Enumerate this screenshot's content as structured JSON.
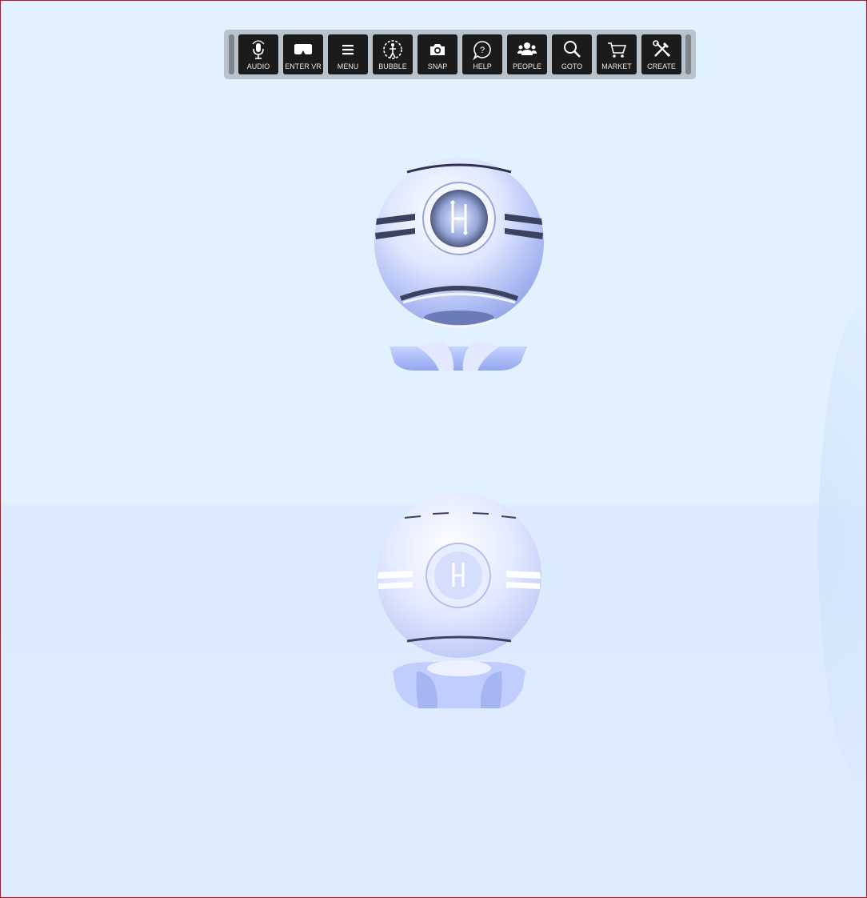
{
  "toolbar": {
    "buttons": [
      {
        "label": "AUDIO",
        "icon": "microphone-icon"
      },
      {
        "label": "ENTER VR",
        "icon": "vr-headset-icon"
      },
      {
        "label": "MENU",
        "icon": "hamburger-menu-icon"
      },
      {
        "label": "BUBBLE",
        "icon": "bubble-icon"
      },
      {
        "label": "SNAP",
        "icon": "camera-icon"
      },
      {
        "label": "HELP",
        "icon": "help-icon"
      },
      {
        "label": "PEOPLE",
        "icon": "people-icon"
      },
      {
        "label": "GOTO",
        "icon": "search-icon"
      },
      {
        "label": "MARKET",
        "icon": "cart-icon"
      },
      {
        "label": "CREATE",
        "icon": "create-tools-icon"
      }
    ]
  },
  "colors": {
    "background": "#e1f1ff",
    "floor": "#dfecfd",
    "toolbar_bg": "#b8c3cc",
    "button_bg": "#1b1b1b",
    "avatar_body": "#c8d6ff",
    "border": "#d0101a"
  },
  "scene": {
    "objects": [
      "robot-avatar",
      "robot-avatar-reflection"
    ]
  }
}
